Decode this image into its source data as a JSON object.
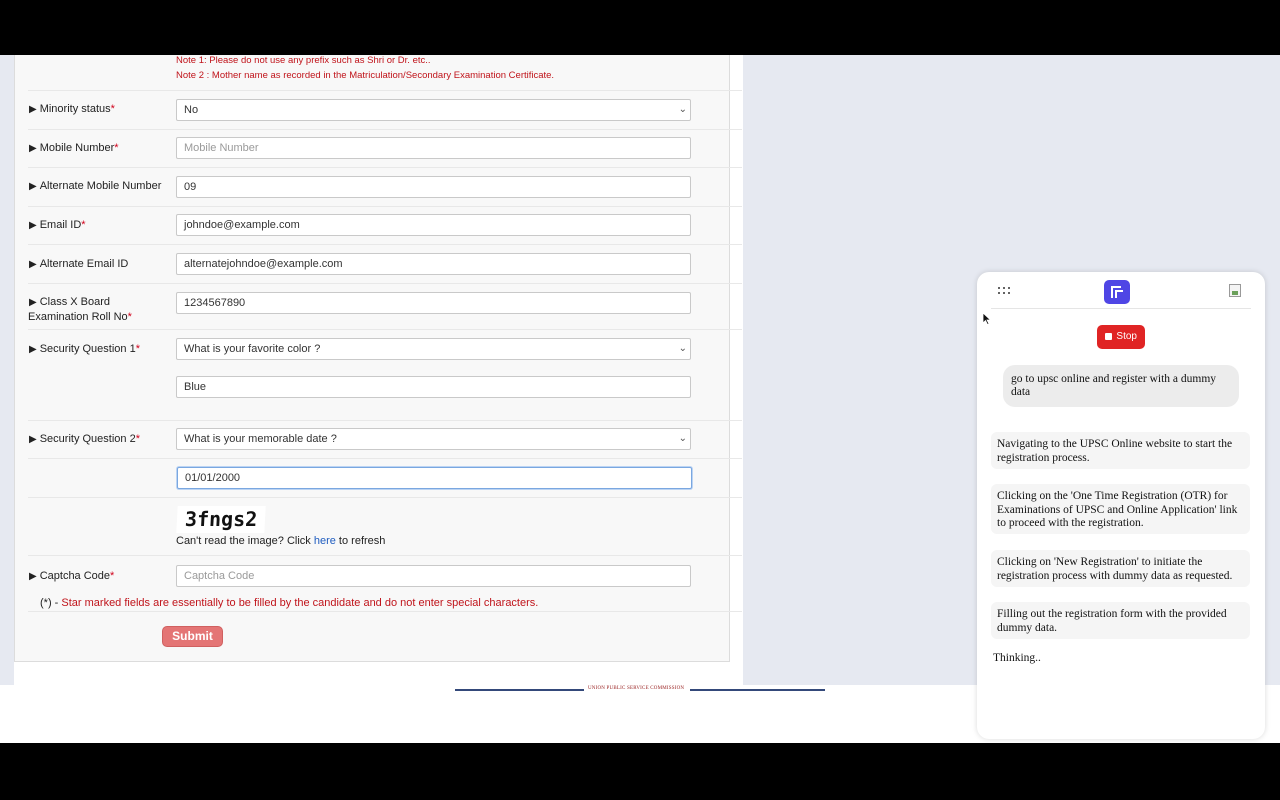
{
  "form": {
    "notes": [
      "Note 1: Please do not use any prefix such as Shri or Dr. etc..",
      "Note 2 : Mother name as recorded in the Matriculation/Secondary Examination Certificate."
    ],
    "required_mark": "*",
    "fields": {
      "minority": {
        "label": "Minority status",
        "value": "No"
      },
      "mobile": {
        "label": "Mobile Number",
        "placeholder": "Mobile Number"
      },
      "alt_mobile": {
        "label": "Alternate Mobile Number",
        "value": "09"
      },
      "email": {
        "label": "Email ID",
        "value": "johndoe@example.com"
      },
      "alt_email": {
        "label": "Alternate Email ID",
        "value": "alternatejohndoe@example.com"
      },
      "roll_no": {
        "label_line1": "Class X Board",
        "label_line2": "Examination Roll No",
        "value": "1234567890"
      },
      "sec_q1": {
        "label": "Security Question 1",
        "value": "What is your favorite color ?",
        "answer": "Blue"
      },
      "sec_q2": {
        "label": "Security Question 2",
        "value": "What is your memorable date ?",
        "answer": "01/01/2000"
      },
      "captcha": {
        "label": "Captcha Code",
        "placeholder": "Captcha Code",
        "image_text": "3fngs2"
      }
    },
    "refresh_prefix": "Can't read the image? Click ",
    "refresh_link": "here",
    "refresh_suffix": " to refresh",
    "star_note_prefix": "(*) - ",
    "star_note": "Star marked fields are essentially to be filled by the candidate and do not enter special characters.",
    "submit_label": "Submit"
  },
  "footer": {
    "text": "UNION PUBLIC SERVICE COMMISSION"
  },
  "assistant": {
    "stop_label": "Stop",
    "user_message": "go to upsc online and register with a dummy data",
    "steps": [
      "Navigating to the UPSC Online website to start the registration process.",
      "Clicking on the 'One Time Registration (OTR) for Examinations of UPSC and Online Application' link to proceed with the registration.",
      "Clicking on 'New Registration' to initiate the registration process with dummy data as requested.",
      "Filling out the registration form with the provided dummy data."
    ],
    "status": "Thinking..",
    "accent_color": "#4f46e5",
    "stop_color": "#e02424"
  }
}
